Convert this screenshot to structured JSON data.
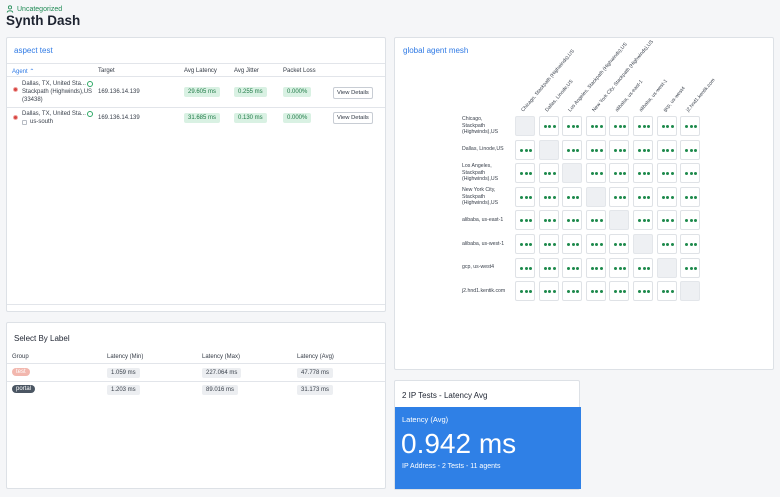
{
  "breadcrumb": "Uncategorized",
  "page_title": "Synth Dash",
  "aspect_test": {
    "title": "aspect test",
    "columns": [
      "Agent",
      "Target",
      "Avg Latency",
      "Avg Jitter",
      "Packet Loss"
    ],
    "rows": [
      {
        "agent_line1": "Dallas, TX, United Sta...",
        "agent_line2": "Stackpath (Highwinds),US",
        "agent_line3": "(33438)",
        "target": "169.136.14.139",
        "latency": "29.605 ms",
        "jitter": "0.255 ms",
        "loss": "0.000%",
        "action": "View Details"
      },
      {
        "agent_line1": "Dallas, TX, United Sta...",
        "agent_line2": "us-south",
        "agent_line3": "",
        "target": "169.136.14.139",
        "latency": "31.685 ms",
        "jitter": "0.130 ms",
        "loss": "0.000%",
        "action": "View Details"
      }
    ]
  },
  "select_by_label": {
    "title": "Select By Label",
    "columns": [
      "Group",
      "Latency (Min)",
      "Latency (Max)",
      "Latency (Avg)"
    ],
    "rows": [
      {
        "group": "test",
        "group_color": "#f2b7ae",
        "min": "1.059 ms",
        "max": "227.064 ms",
        "avg": "47.778 ms"
      },
      {
        "group": "portal",
        "group_color": "#4b5663",
        "min": "1.203 ms",
        "max": "89.016 ms",
        "avg": "31.173 ms"
      }
    ]
  },
  "mesh": {
    "title": "global agent mesh",
    "columns": [
      "Chicago, Stackpath (Highwinds),US",
      "Dallas, Linode,US",
      "Los Angeles, Stackpath (Highwinds),US",
      "New York City, Stackpath (Highwinds),US",
      "alibaba, us-east-1",
      "alibaba, us-west-1",
      "gcp, us-west4",
      "j2.hnd1.kentik.com"
    ],
    "rows": [
      [
        "Chicago,",
        "Stackpath",
        "(Highwinds),US"
      ],
      [
        "Dallas, Linode,US"
      ],
      [
        "Los Angeles,",
        "Stackpath",
        "(Highwinds),US"
      ],
      [
        "New York City,",
        "Stackpath",
        "(Highwinds),US"
      ],
      [
        "alibaba, us-east-1"
      ],
      [
        "alibaba, us-west-1"
      ],
      [
        "gcp, us-west4"
      ],
      [
        "j2.hnd1.kentik.com"
      ]
    ],
    "status_color": "#1e8a4c"
  },
  "ip_tests": {
    "title": "2 IP Tests - Latency Avg",
    "metric_label": "Latency (Avg)",
    "value": "0.942 ms",
    "subtitle": "IP Address - 2 Tests - 11 agents"
  }
}
